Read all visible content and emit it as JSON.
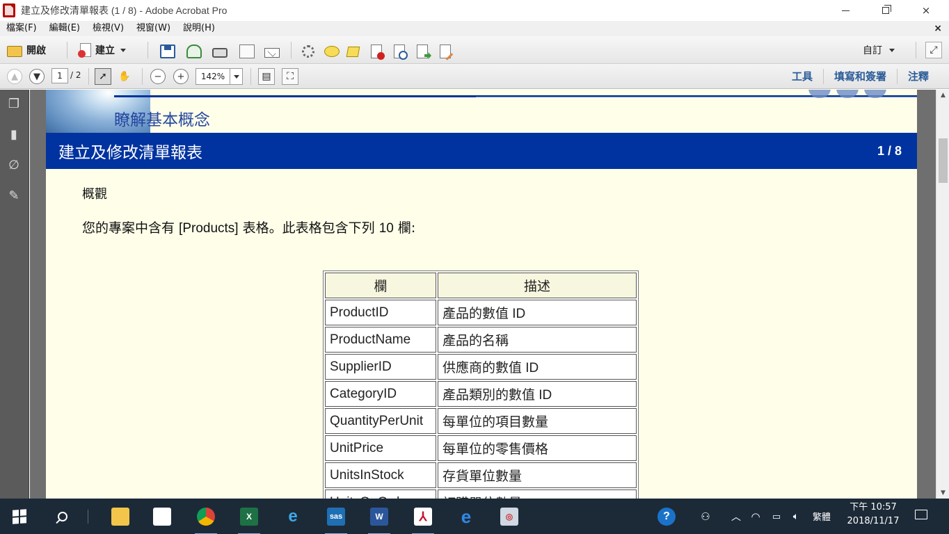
{
  "window": {
    "title": "建立及修改清單報表 (1 / 8) - Adobe Acrobat Pro"
  },
  "menubar": {
    "items": [
      "檔案(F)",
      "編輯(E)",
      "檢視(V)",
      "視窗(W)",
      "說明(H)"
    ],
    "close_glyph": "×"
  },
  "toolbar": {
    "open_label": "開啟",
    "create_label": "建立",
    "customize_label": "自訂"
  },
  "nav": {
    "current_page": "1",
    "total_pages": "/ 2",
    "zoom": "142%"
  },
  "panes": {
    "tools": "工具",
    "fill_sign": "填寫和簽署",
    "comment": "注釋"
  },
  "document": {
    "section_label": "瞭解基本概念",
    "title": "建立及修改清單報表",
    "page_indicator": "1 / 8",
    "overview_heading": "概觀",
    "intro_prefix": "您的專案中含有 ",
    "intro_table": "[Products]",
    "intro_mid": " 表格。此表格包含下列 ",
    "intro_count": "10",
    "intro_suffix": " 欄:",
    "table": {
      "headers": [
        "欄",
        "描述"
      ],
      "rows": [
        [
          "ProductID",
          "產品的數值 ID"
        ],
        [
          "ProductName",
          "產品的名稱"
        ],
        [
          "SupplierID",
          "供應商的數值 ID"
        ],
        [
          "CategoryID",
          "產品類別的數值 ID"
        ],
        [
          "QuantityPerUnit",
          "每單位的項目數量"
        ],
        [
          "UnitPrice",
          "每單位的零售價格"
        ],
        [
          "UnitsInStock",
          "存貨單位數量"
        ],
        [
          "UnitsOnOrder",
          "訂購單位數量"
        ]
      ]
    }
  },
  "taskbar": {
    "apps": [
      "file-explorer",
      "store",
      "chrome",
      "excel",
      "internet-explorer",
      "sas",
      "word",
      "acrobat",
      "edge",
      "other-app"
    ],
    "sas_label": "sas",
    "input_method": "繁體",
    "time": "下午 10:57",
    "date": "2018/11/17"
  },
  "colors": {
    "title_band": "#0033a0",
    "page_background": "#fefee9",
    "link_blue": "#2b5c98",
    "taskbar": "#1c2a38"
  }
}
